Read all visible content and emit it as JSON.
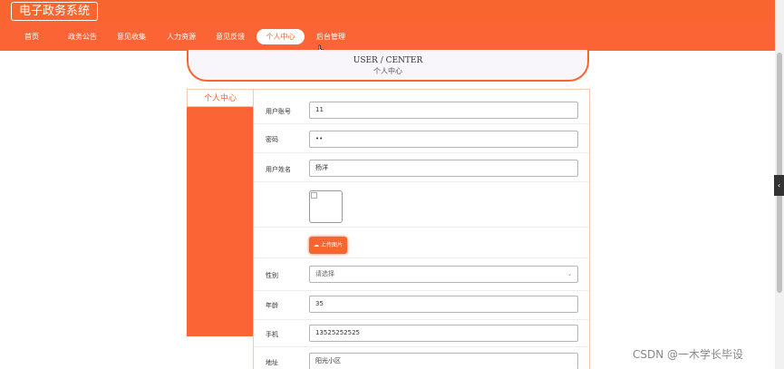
{
  "app": {
    "title": "电子政务系统"
  },
  "nav": {
    "items": [
      {
        "label": "首页"
      },
      {
        "label": "政务公告"
      },
      {
        "label": "意见收集"
      },
      {
        "label": "人力资源"
      },
      {
        "label": "意见反馈"
      },
      {
        "label": "个人中心",
        "active": true
      },
      {
        "label": "后台管理"
      }
    ]
  },
  "header": {
    "title_en": "USER / CENTER",
    "title_cn": "个人中心"
  },
  "sidebar": {
    "title": "个人中心"
  },
  "form": {
    "account": {
      "label": "用户账号",
      "value": "11"
    },
    "password": {
      "label": "密码",
      "value": "••"
    },
    "name": {
      "label": "用户姓名",
      "value": "杨洋"
    },
    "upload_label": "上传图片",
    "gender": {
      "label": "性别",
      "value": "请选择"
    },
    "age": {
      "label": "年龄",
      "value": "35"
    },
    "phone": {
      "label": "手机",
      "value": "13525252525"
    },
    "address": {
      "label": "地址",
      "value": "阳光小区"
    }
  },
  "watermark": "CSDN @一木学长毕设",
  "colors": {
    "accent": "#f8652f",
    "nav_bg": "#fb6536"
  }
}
